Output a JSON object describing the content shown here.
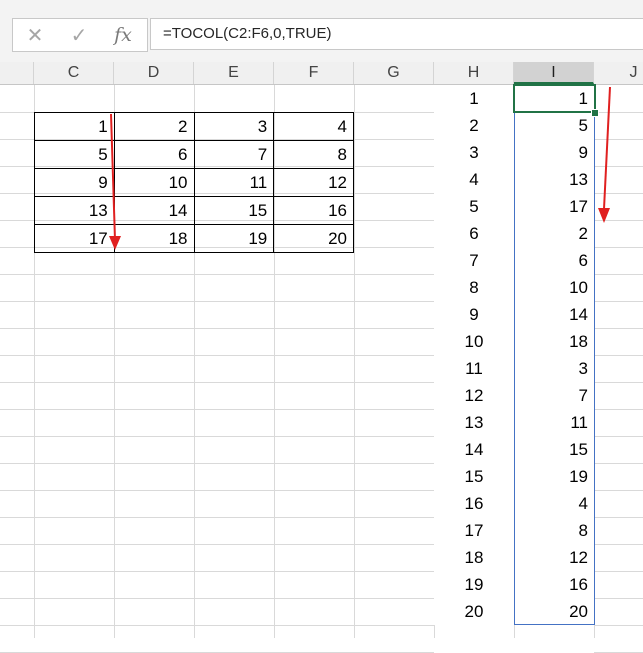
{
  "formula_bar": {
    "cancel_glyph": "✕",
    "enter_glyph": "✓",
    "fx_label": "fx",
    "formula": "=TOCOL(C2:F6,0,TRUE)"
  },
  "columns": [
    "C",
    "D",
    "E",
    "F",
    "G",
    "H",
    "I",
    "J"
  ],
  "selected_column": "I",
  "source_table": [
    [
      "1",
      "2",
      "3",
      "4"
    ],
    [
      "5",
      "6",
      "7",
      "8"
    ],
    [
      "9",
      "10",
      "11",
      "12"
    ],
    [
      "13",
      "14",
      "15",
      "16"
    ],
    [
      "17",
      "18",
      "19",
      "20"
    ]
  ],
  "index_column": [
    "1",
    "2",
    "3",
    "4",
    "5",
    "6",
    "7",
    "8",
    "9",
    "10",
    "11",
    "12",
    "13",
    "14",
    "15",
    "16",
    "17",
    "18",
    "19",
    "20"
  ],
  "result_column": [
    "1",
    "5",
    "9",
    "13",
    "17",
    "2",
    "6",
    "10",
    "14",
    "18",
    "3",
    "7",
    "11",
    "15",
    "19",
    "4",
    "8",
    "12",
    "16",
    "20"
  ],
  "arrow_color": "#e02020"
}
